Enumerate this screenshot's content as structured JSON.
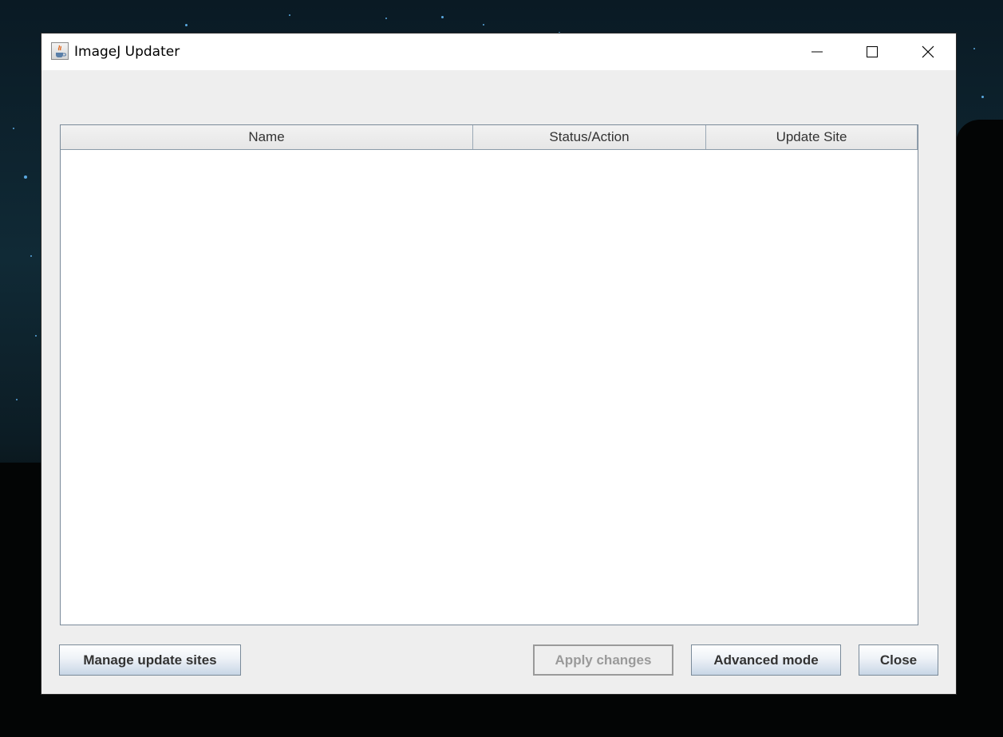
{
  "window": {
    "title": "ImageJ Updater",
    "icon": "java-cup-icon"
  },
  "title_controls": {
    "minimize": "minimize-icon",
    "maximize": "maximize-icon",
    "close": "close-icon"
  },
  "table": {
    "columns": [
      "Name",
      "Status/Action",
      "Update Site"
    ],
    "rows": []
  },
  "buttons": {
    "manage_update_sites": "Manage update sites",
    "apply_changes": "Apply changes",
    "advanced_mode": "Advanced mode",
    "close": "Close"
  },
  "colors": {
    "window_background": "#eeeeee",
    "title_bar": "#ffffff",
    "disabled_text": "#9a9a9a",
    "button_gradient_bottom": "#c8d6e6"
  }
}
